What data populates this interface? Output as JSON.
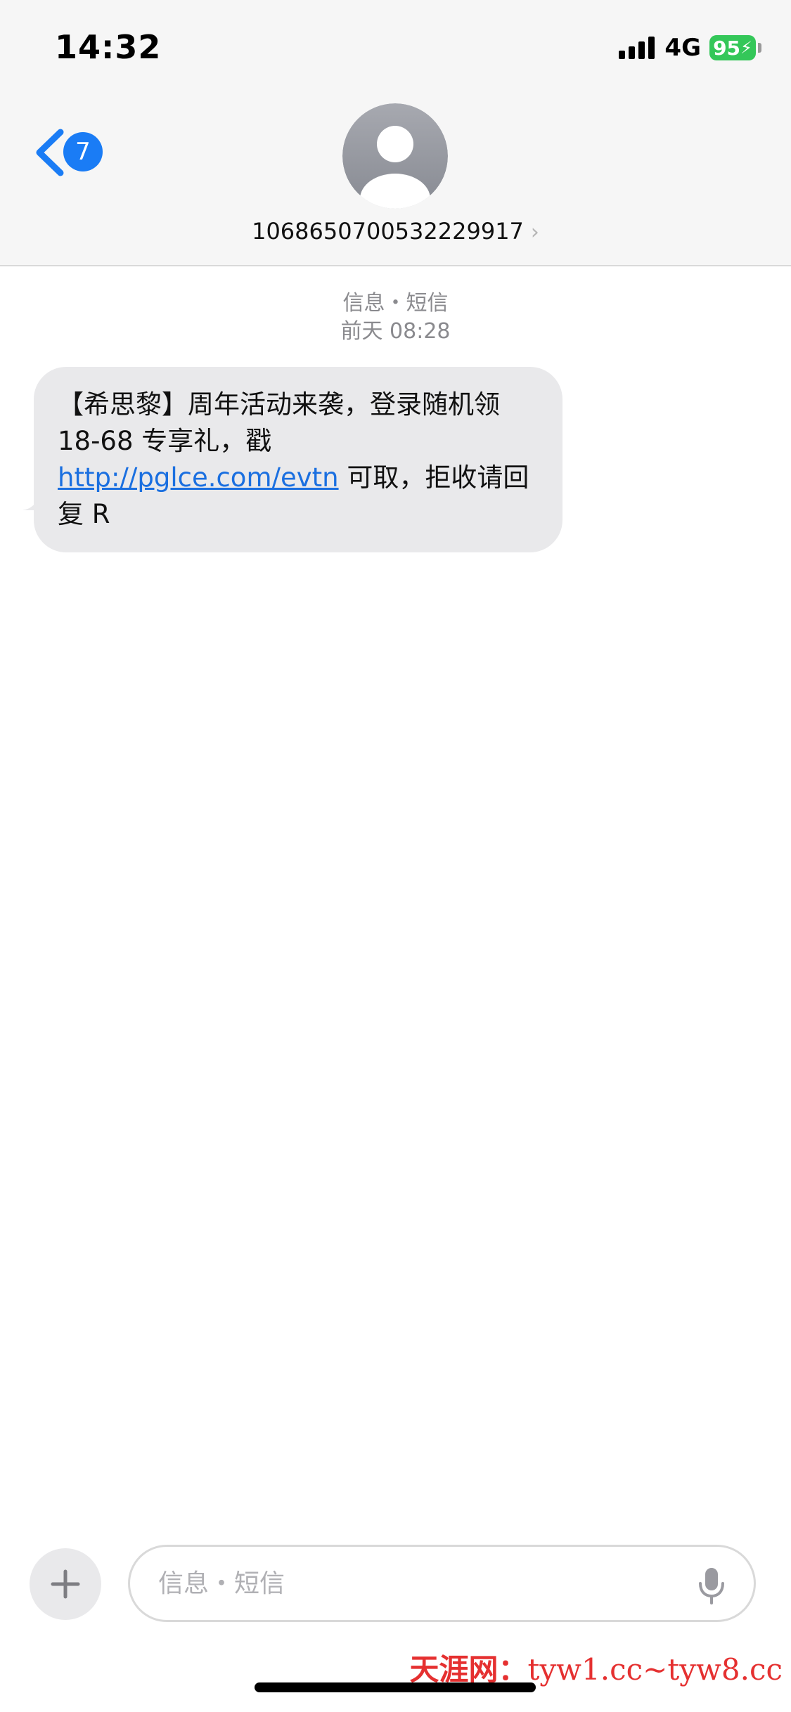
{
  "status_bar": {
    "time": "14:32",
    "network": "4G",
    "battery": "95"
  },
  "nav": {
    "back_badge": "7",
    "contact_number": "1068650700532229917"
  },
  "thread": {
    "service_label": "信息・短信",
    "timestamp": "前天 08:28",
    "message": {
      "text_before_link": "【希思黎】周年活动来袭，登录随机领 18-68 专享礼，戳 ",
      "link": "http://pglce.com/evtn",
      "text_after_link": " 可取，拒收请回复 R"
    }
  },
  "composer": {
    "placeholder": "信息・短信"
  },
  "watermark": {
    "site_name": "天涯网：",
    "domains": "tyw1.cc~tyw8.cc"
  },
  "colors": {
    "link": "#1a6fe0",
    "badge": "#1a7cf5",
    "battery": "#34c759",
    "bubble": "#e9e9eb"
  },
  "icons": [
    "back-chevron-icon",
    "contact-avatar-icon",
    "plus-icon",
    "microphone-icon",
    "signal-icon",
    "battery-icon"
  ]
}
